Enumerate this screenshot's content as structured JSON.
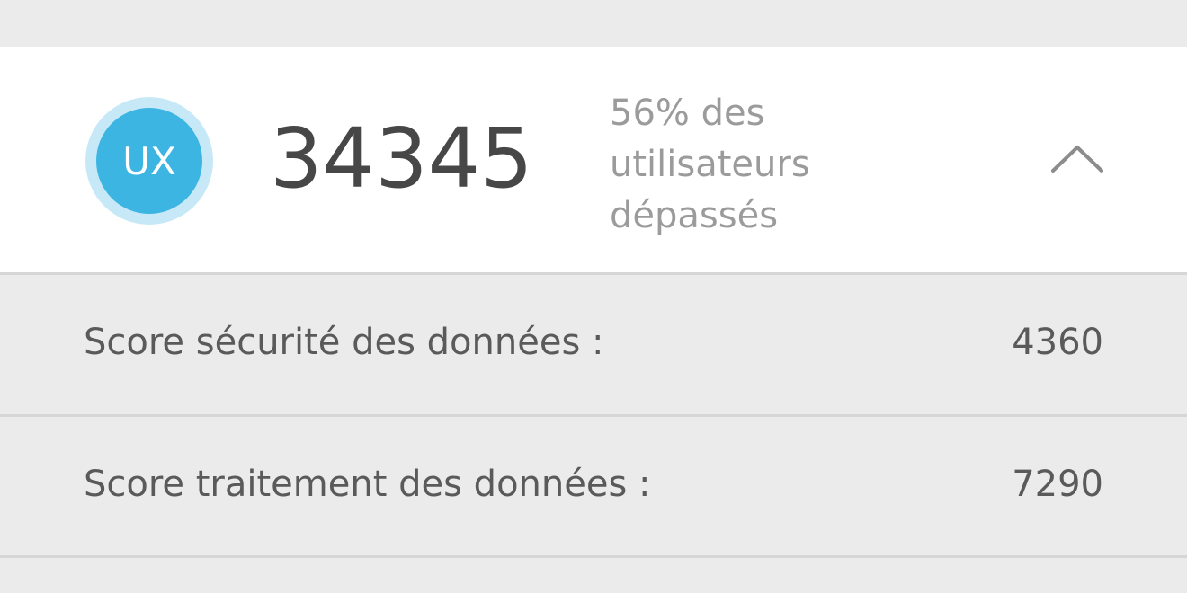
{
  "summary": {
    "badge_label": "UX",
    "score": "34345",
    "rank_line1": "56% des",
    "rank_line2": "utilisateurs",
    "rank_line3": "dépassés",
    "expanded": true,
    "toggle_icon": "chevron-up-icon"
  },
  "details": [
    {
      "label": "Score sécurité des données :",
      "value": "4360"
    },
    {
      "label": "Score traitement des données :",
      "value": "7290"
    }
  ],
  "colors": {
    "badge_ring": "#c7e9f7",
    "badge_fill": "#3cb5e3",
    "score_text": "#474747",
    "muted_text": "#9b9b9b",
    "background": "#ebebeb",
    "card": "#ffffff"
  }
}
